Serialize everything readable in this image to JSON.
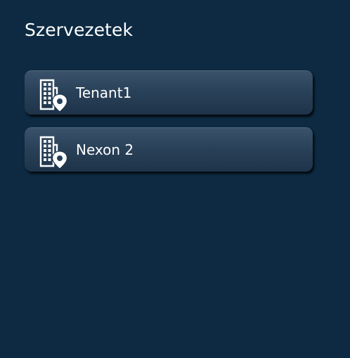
{
  "page": {
    "title": "Szervezetek"
  },
  "organizations": [
    {
      "name": "Tenant1",
      "icon": "building-location-icon"
    },
    {
      "name": "Nexon 2",
      "icon": "building-location-icon"
    }
  ],
  "colors": {
    "background": "#0d2a42",
    "item_top": "#3b536a",
    "item_bottom": "#1d3349",
    "text": "#ffffff"
  }
}
